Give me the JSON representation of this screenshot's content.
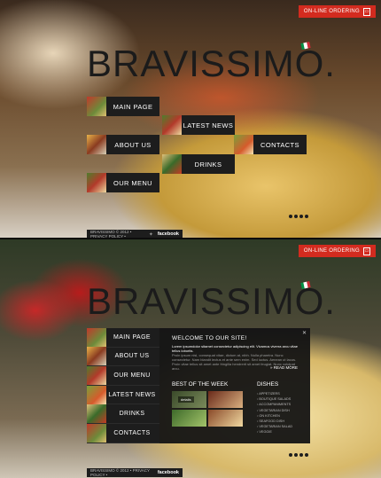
{
  "site": {
    "logo_text": "BRAVISSIMO.",
    "order_label": "ON-LINE ORDERING",
    "flag_colors": [
      "#009246",
      "#ffffff",
      "#ce2b37"
    ]
  },
  "panel1": {
    "tiles": {
      "main_page": "MAIN PAGE",
      "latest_news": "LATEST NEWS",
      "about_us": "ABOUT US",
      "contacts": "CONTACTS",
      "drinks": "DRINKS",
      "our_menu": "OUR MENU"
    },
    "footer": {
      "copyright": "BRAVISSIMO © 2012 • PRIVACY POLICY •",
      "facebook": "facebook"
    }
  },
  "panel2": {
    "nav": [
      {
        "label": "MAIN PAGE"
      },
      {
        "label": "ABOUT US"
      },
      {
        "label": "OUR MENU"
      },
      {
        "label": "LATEST NEWS"
      },
      {
        "label": "DRINKS"
      },
      {
        "label": "CONTACTS"
      }
    ],
    "welcome": {
      "title": "WELCOME TO OUR SITE!",
      "lead": "Lorem ipsumdolor sitamet consectetur adipiscing elit. Vivamus viverra arcu vitae tellus lobortis.",
      "body": "Proin ipsum nisl, consequat vitae, dictum at, nibh. Nulla pharetra. Nunc consectetur. Nam blandit lectus et ante sem enim. Sed luctus. Aenean ut lacus. Proin vitae tellus sit amet ante fringilla hendrerit sit amet feugiat. Nunc volutpat arcu.",
      "read_more": "» READ MORE"
    },
    "best_of_week": {
      "title": "BEST OF THE WEEK",
      "details": "details"
    },
    "dishes": {
      "title": "DISHES",
      "items": [
        "APPETIZERS",
        "BOUTIQUE SALADS",
        "ACCOMPANIMENTS",
        "VEGETARIAN DISH",
        "ON KITCHEN",
        "SEAFOOD DISH",
        "VEGETARIAN SALAD",
        "VEGGIE"
      ]
    },
    "footer": {
      "copyright": "BRAVISSIMO © 2012 • PRIVACY POLICY •",
      "facebook": "facebook"
    }
  }
}
